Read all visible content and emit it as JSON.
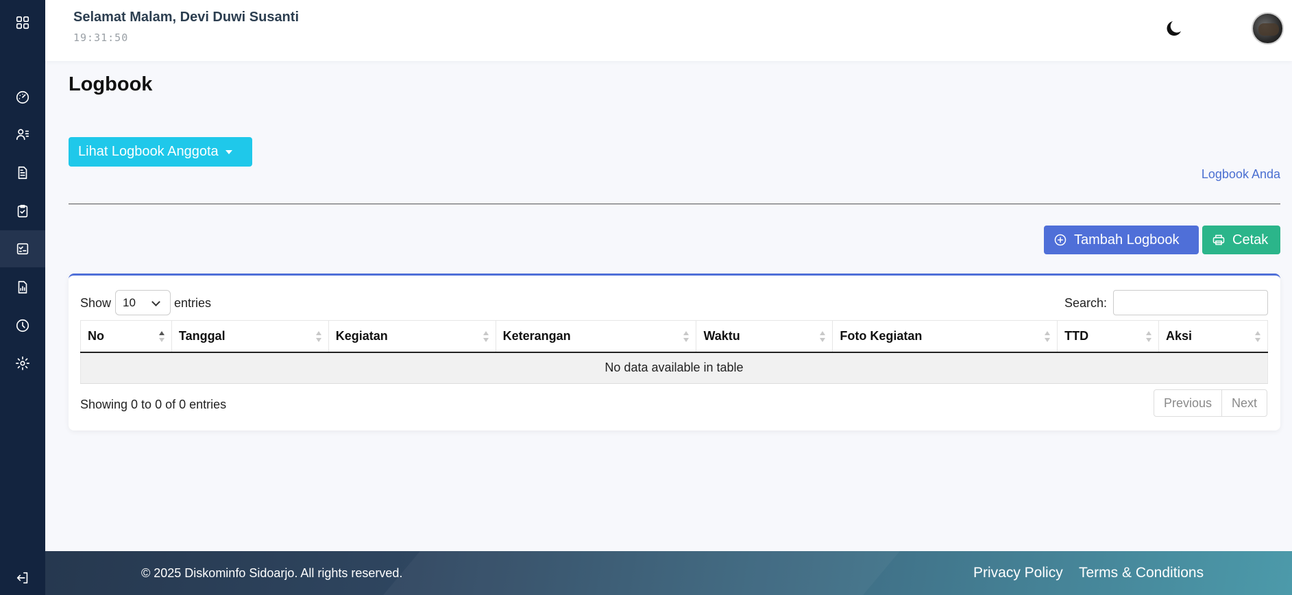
{
  "header": {
    "greeting": "Selamat Malam, Devi Duwi Susanti",
    "time": "19:31:50"
  },
  "sidebar": {
    "items": [
      {
        "icon": "grid-icon"
      },
      {
        "icon": "dashboard-gauge-icon"
      },
      {
        "icon": "user-list-icon"
      },
      {
        "icon": "document-icon"
      },
      {
        "icon": "clipboard-check-icon"
      },
      {
        "icon": "checklist-icon",
        "active": true
      },
      {
        "icon": "report-chart-icon"
      },
      {
        "icon": "clock-icon"
      },
      {
        "icon": "gear-icon"
      },
      {
        "icon": "logout-icon"
      }
    ]
  },
  "main": {
    "title": "Logbook",
    "member_dropdown_label": "Lihat Logbook Anggota",
    "your_logbook_link": "Logbook Anda",
    "add_button_label": "Tambah Logbook",
    "print_button_label": "Cetak"
  },
  "table": {
    "show_label": "Show",
    "page_length": "10",
    "entries_label": "entries",
    "search_label": "Search:",
    "search_value": "",
    "columns": [
      "No",
      "Tanggal",
      "Kegiatan",
      "Keterangan",
      "Waktu",
      "Foto Kegiatan",
      "TTD",
      "Aksi"
    ],
    "empty_message": "No data available in table",
    "info": "Showing 0 to 0 of 0 entries",
    "prev_label": "Previous",
    "next_label": "Next"
  },
  "footer": {
    "copyright": "© 2025 Diskominfo Sidoarjo. All rights reserved.",
    "privacy": "Privacy Policy",
    "terms": "Terms & Conditions"
  },
  "colors": {
    "sidebar": "#13243f",
    "accent_cyan": "#1fc8ea",
    "accent_blue": "#4f6fd8",
    "accent_green": "#2bb58a"
  }
}
